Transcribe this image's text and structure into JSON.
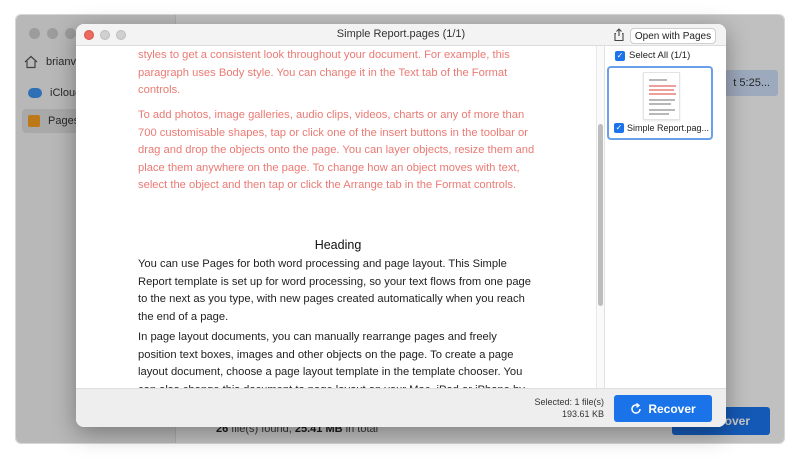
{
  "background_app": {
    "user_name": "brianv",
    "sidebar_items": [
      {
        "label": "iCloud",
        "icon": "cloud-icon"
      },
      {
        "label": "Pages",
        "icon": "pages-icon"
      }
    ],
    "row_time": "t 5:25...",
    "status_count": "26",
    "status_text1": " file(s) found, ",
    "status_size": "25.41 MB",
    "status_text2": " in total",
    "recover_label": "cover"
  },
  "dialog": {
    "title": "Simple Report.pages (1/1)",
    "open_button": "Open with Pages",
    "select_all": "Select All (1/1)",
    "thumbnail_label": "Simple Report.pag...",
    "document": {
      "para1": "styles to get a consistent look throughout your document. For example, this paragraph uses Body style. You can change it in the Text tab of the Format controls.",
      "para2": "To add photos, image galleries, audio clips, videos, charts or any of more than 700 customisable shapes, tap or click one of the insert buttons in the toolbar or drag and drop the objects onto the page. You can layer objects, resize them and place them anywhere on the page. To change how an object moves with text, select the object and then tap or click the Arrange tab in the Format controls.",
      "heading": "Heading",
      "para3": "You can use Pages for both word processing and page layout. This Simple Report template is set up for word processing, so your text flows from one page to the next as you type, with new pages created automatically when you reach the end of a page.",
      "para4": "In page layout documents, you can manually rearrange pages and freely position text boxes, images and other objects on the page. To create a page layout document, choose a page layout template in the template chooser. You can also change this document to page layout on your Mac, iPad or iPhone by turning off Document Body in the Document controls."
    },
    "footer": {
      "selected": "Selected: 1 file(s)",
      "size": "193.61 KB",
      "recover": "Recover"
    }
  },
  "colors": {
    "accent": "#1a73e8",
    "pink_text": "#ea7a74",
    "close_red": "#ed6a5e"
  }
}
